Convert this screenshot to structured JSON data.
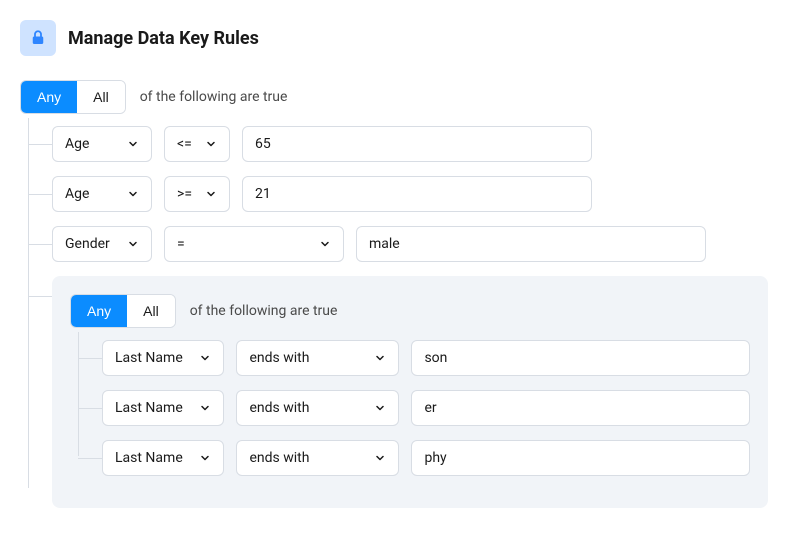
{
  "header": {
    "title": "Manage Data Key Rules"
  },
  "group": {
    "toggleAny": "Any",
    "toggleAll": "All",
    "label": "of the following are true",
    "rules": [
      {
        "field": "Age",
        "operator": "<=",
        "value": "65"
      },
      {
        "field": "Age",
        "operator": ">=",
        "value": "21"
      },
      {
        "field": "Gender",
        "operator": "=",
        "value": "male"
      }
    ],
    "nested": {
      "toggleAny": "Any",
      "toggleAll": "All",
      "label": "of the following are true",
      "rules": [
        {
          "field": "Last Name",
          "operator": "ends with",
          "value": "son"
        },
        {
          "field": "Last Name",
          "operator": "ends with",
          "value": "er"
        },
        {
          "field": "Last Name",
          "operator": "ends with",
          "value": "phy"
        }
      ]
    }
  }
}
